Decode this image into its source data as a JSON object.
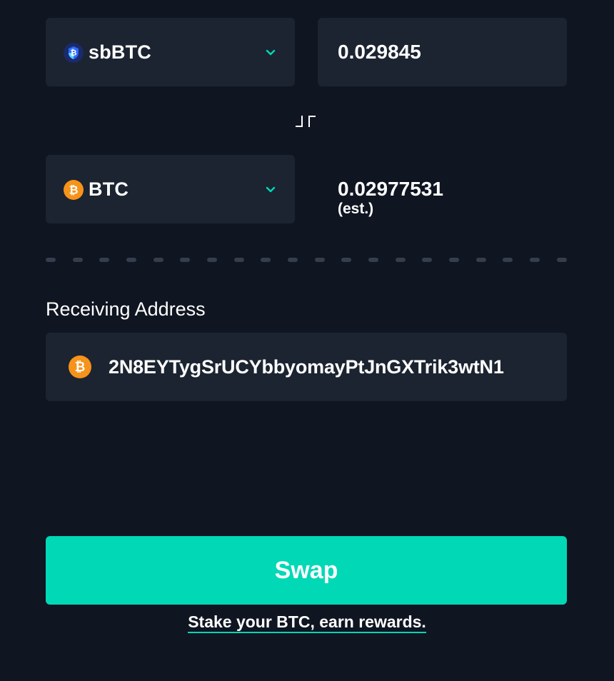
{
  "swap_form": {
    "from": {
      "token_label": "sbBTC",
      "token_icon": "sbbtc-shield-icon",
      "amount_value": "0.029845"
    },
    "swap_direction_icon": "swap-arrows-icon",
    "to": {
      "token_label": "BTC",
      "token_icon": "bitcoin-icon",
      "estimated_amount": "0.02977531",
      "estimate_note": "(est.)"
    },
    "receiving_address": {
      "label": "Receiving Address",
      "icon": "bitcoin-icon",
      "value": "2N8EYTygSrUCYbbyomayPtJnGXTrik3wtN1"
    },
    "swap_button_label": "Swap",
    "stake_link_text": "Stake your BTC, earn rewards."
  },
  "colors": {
    "background": "#0f1521",
    "field_background": "#1c2431",
    "accent": "#00d8b6",
    "bitcoin_orange": "#f7931a",
    "divider": "#343e4d"
  }
}
